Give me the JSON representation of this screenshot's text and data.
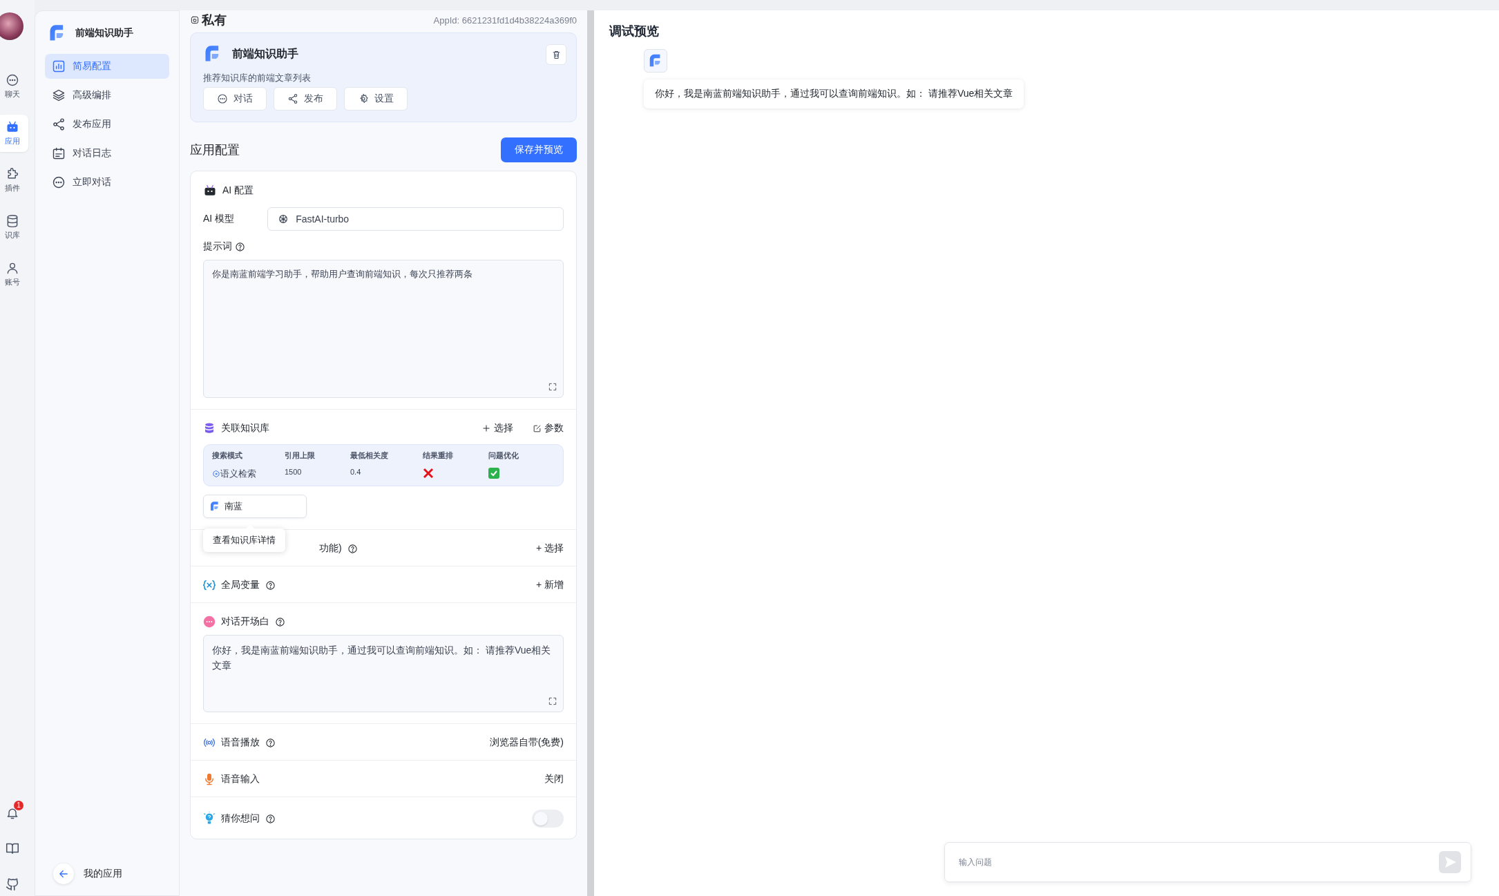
{
  "rail": {
    "items": [
      {
        "label": "聊天",
        "kind": "chat",
        "selected": false
      },
      {
        "label": "应用",
        "kind": "app",
        "selected": true
      },
      {
        "label": "插件",
        "kind": "plugin",
        "selected": false
      },
      {
        "label": "识库",
        "kind": "dataset",
        "selected": false
      },
      {
        "label": "账号",
        "kind": "account",
        "selected": false
      }
    ],
    "notifications": "1"
  },
  "sidebar": {
    "app_name": "前端知识助手",
    "items": [
      {
        "label": "简易配置",
        "kind": "chart",
        "selected": true
      },
      {
        "label": "高级编排",
        "kind": "layers",
        "selected": false
      },
      {
        "label": "发布应用",
        "kind": "share",
        "selected": false
      },
      {
        "label": "对话日志",
        "kind": "log",
        "selected": false
      },
      {
        "label": "立即对话",
        "kind": "chat",
        "selected": false
      }
    ],
    "back_label": "我的应用"
  },
  "header": {
    "visibility": "私有",
    "app_id": "AppId: 6621231fd1d4b38224a369f0"
  },
  "app_card": {
    "name": "前端知识助手",
    "description": "推荐知识库的前端文章列表",
    "actions": [
      {
        "label": "对话",
        "kind": "chat"
      },
      {
        "label": "发布",
        "kind": "share"
      },
      {
        "label": "设置",
        "kind": "settings"
      }
    ]
  },
  "config": {
    "title": "应用配置",
    "save_button": "保存并预览",
    "ai": {
      "title": "AI 配置",
      "model_label": "AI 模型",
      "model": "FastAI-turbo",
      "prompt_label": "提示词",
      "prompt": "你是南蓝前端学习助手，帮助用户查询前端知识，每次只推荐两条"
    },
    "dataset": {
      "title": "关联知识库",
      "select": "选择",
      "params": "参数",
      "columns": [
        "搜索模式",
        "引用上限",
        "最低相关度",
        "结果重排",
        "问题优化"
      ],
      "search_mode": "语义检索",
      "limit": "1500",
      "similarity": "0.4",
      "rerank": false,
      "optimize": true,
      "items": [
        "南蓝"
      ],
      "tooltip": "查看知识库详情"
    },
    "sections": [
      {
        "kind": "tools",
        "label": "功能)",
        "action": "+ 选择"
      },
      {
        "kind": "variables",
        "label": "全局变量",
        "action": "+ 新增"
      },
      {
        "kind": "welcome",
        "label": "对话开场白",
        "text": "你好，我是南蓝前端知识助手，通过我可以查询前端知识。如： 请推荐Vue相关文章"
      },
      {
        "kind": "tts",
        "label": "语音播放",
        "value": "浏览器自带(免费)"
      },
      {
        "kind": "voice",
        "label": "语音输入",
        "value": "关闭"
      },
      {
        "kind": "guide",
        "label": "猜你想问",
        "enabled": false
      }
    ]
  },
  "preview": {
    "title": "调试预览",
    "welcome": "你好，我是南蓝前端知识助手，通过我可以查询前端知识。如： 请推荐Vue相关文章",
    "input_placeholder": "输入问题"
  }
}
